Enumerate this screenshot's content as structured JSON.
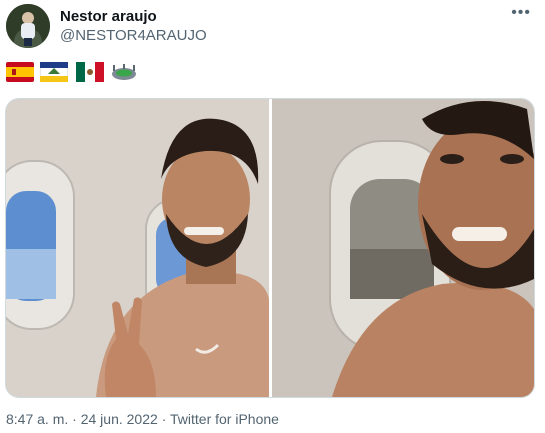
{
  "tweet": {
    "author": {
      "display_name": "Nestor araujo",
      "handle": "@NESTOR4ARAUJO"
    },
    "more_icon": "more-options-icon",
    "flags": [
      "spain-flag",
      "jalisco-flag",
      "mexico-flag",
      "stadium-emblem"
    ],
    "media": {
      "count": 2
    },
    "footer": {
      "time": "8:47 a. m.",
      "separator": "·",
      "date": "24 jun. 2022",
      "source": "Twitter for iPhone"
    }
  }
}
